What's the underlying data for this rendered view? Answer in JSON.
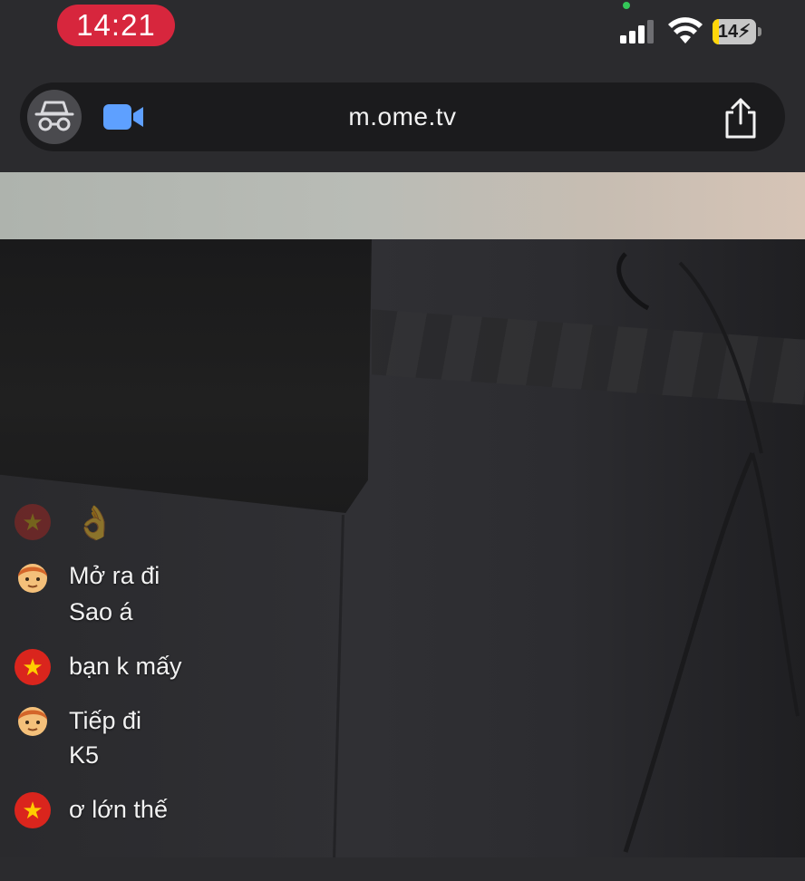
{
  "status_bar": {
    "time": "14:21",
    "battery_level": 14,
    "battery_text": "14",
    "icons": [
      "signal-icon",
      "wifi-icon",
      "battery-icon"
    ],
    "time_pill_color": "#d7263d",
    "camera_indicator_color": "#34c759"
  },
  "toolbar": {
    "url": "m.ome.tv",
    "icons": [
      "private-browsing-icon",
      "video-camera-icon",
      "share-icon"
    ],
    "accent_color": "#5ea0ff"
  },
  "chat": {
    "messages": [
      {
        "avatar": "flag-icon",
        "lines": [
          "👌"
        ]
      },
      {
        "avatar": "boy-emoji-icon",
        "lines": [
          "Mở ra đi",
          "Sao á"
        ]
      },
      {
        "avatar": "flag-icon",
        "lines": [
          "bạn k mấy"
        ]
      },
      {
        "avatar": "boy-emoji-icon",
        "lines": [
          "Tiếp đi",
          "K5"
        ]
      },
      {
        "avatar": "flag-icon",
        "lines": [
          "ơ lớn thế"
        ]
      }
    ]
  }
}
